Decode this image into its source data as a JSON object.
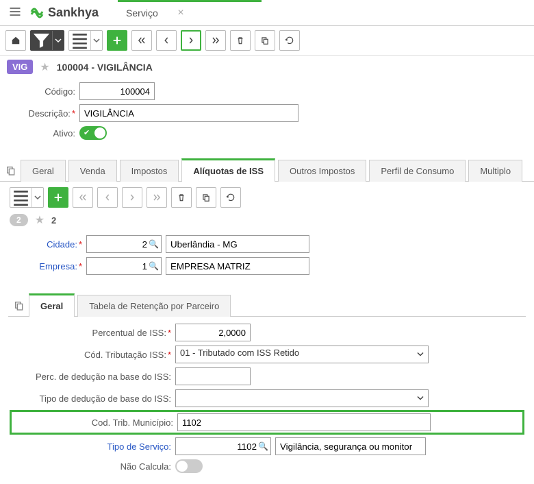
{
  "app": {
    "brand": "Sankhya",
    "tab_title": "Serviço"
  },
  "record": {
    "badge": "VIG",
    "title": "100004 - VIGILÂNCIA",
    "codigo_label": "Código:",
    "codigo_value": "100004",
    "descricao_label": "Descrição:",
    "descricao_value": "VIGILÂNCIA",
    "ativo_label": "Ativo:"
  },
  "tabs": {
    "geral": "Geral",
    "venda": "Venda",
    "impostos": "Impostos",
    "aliquotas": "Alíquotas de ISS",
    "outros": "Outros Impostos",
    "perfil": "Perfil de Consumo",
    "multiplo": "Multiplo"
  },
  "aliq": {
    "count": "2",
    "star_count": "2",
    "cidade_label": "Cidade:",
    "cidade_code": "2",
    "cidade_desc": "Uberlândia - MG",
    "empresa_label": "Empresa:",
    "empresa_code": "1",
    "empresa_desc": "EMPRESA MATRIZ"
  },
  "inner_tabs": {
    "geral": "Geral",
    "retencao": "Tabela de Retenção por Parceiro"
  },
  "detail": {
    "perc_iss_label": "Percentual de ISS:",
    "perc_iss_value": "2,0000",
    "cod_trib_iss_label": "Cód. Tributação ISS:",
    "cod_trib_iss_value": "01 - Tributado com ISS Retido",
    "perc_deducao_label": "Perc. de dedução na base do ISS:",
    "perc_deducao_value": "",
    "tipo_deducao_label": "Tipo de dedução de base do ISS:",
    "tipo_deducao_value": "",
    "cod_trib_mun_label": "Cod. Trib. Município:",
    "cod_trib_mun_value": "1102",
    "tipo_servico_label": "Tipo de Serviço:",
    "tipo_servico_code": "1102",
    "tipo_servico_desc": "Vigilância, segurança ou monitor",
    "nao_calcula_label": "Não Calcula:"
  }
}
